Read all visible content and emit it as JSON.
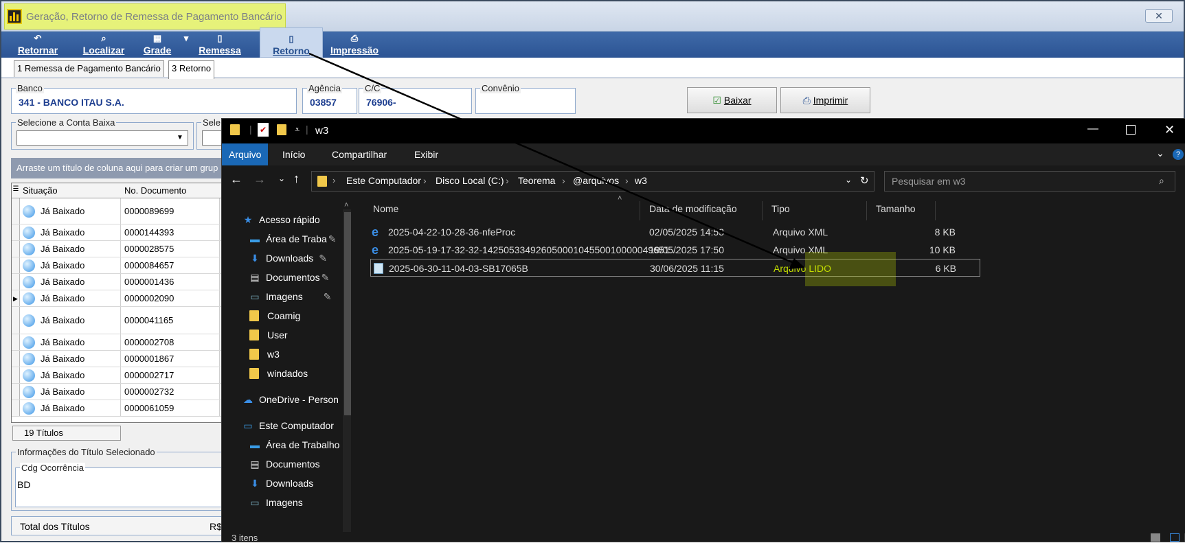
{
  "app": {
    "title": "Geração, Retorno de Remessa de Pagamento Bancário",
    "close": "✕"
  },
  "toolbar": {
    "retornar": "Retornar",
    "localizar": "Localizar",
    "grade": "Grade",
    "remessa": "Remessa",
    "retorno": "Retorno",
    "impressao": "Impressão"
  },
  "tabs": {
    "remessa": "1 Remessa de Pagamento Bancário",
    "retorno": "3 Retorno"
  },
  "form": {
    "banco_label": "Banco",
    "banco_value": "341 - BANCO ITAU S.A.",
    "agencia_label": "Agência",
    "agencia_value": "03857",
    "cc_label": "C/C",
    "cc_value": "76906-",
    "convenio_label": "Convênio",
    "baixar": "Baixar",
    "imprimir": "Imprimir",
    "conta_baixa_label": "Selecione a Conta Baixa",
    "sele_label": "Sele",
    "group_hint": "Arraste um título de coluna aqui para criar um grup"
  },
  "grid": {
    "col_situacao": "Situação",
    "col_documento": "No. Documento",
    "rows": [
      {
        "situacao": "Já Baixado",
        "documento": "0000089699"
      },
      {
        "situacao": "Já Baixado",
        "documento": "0000144393"
      },
      {
        "situacao": "Já Baixado",
        "documento": "0000028575"
      },
      {
        "situacao": "Já Baixado",
        "documento": "0000084657"
      },
      {
        "situacao": "Já Baixado",
        "documento": "0000001436"
      },
      {
        "situacao": "Já Baixado",
        "documento": "0000002090"
      },
      {
        "situacao": "Já Baixado",
        "documento": "0000041165"
      },
      {
        "situacao": "Já Baixado",
        "documento": "0000002708"
      },
      {
        "situacao": "Já Baixado",
        "documento": "0000001867"
      },
      {
        "situacao": "Já Baixado",
        "documento": "0000002717"
      },
      {
        "situacao": "Já Baixado",
        "documento": "0000002732"
      },
      {
        "situacao": "Já Baixado",
        "documento": "0000061059"
      }
    ],
    "count": "19 Títulos"
  },
  "info": {
    "title": "Informações do Título Selecionado",
    "cdg_label": "Cdg Ocorrência",
    "cdg_value": "BD",
    "total_label": "Total dos Títulos",
    "total_currency": "R$"
  },
  "explorer": {
    "title": "w3",
    "ribbon": [
      "Arquivo",
      "Início",
      "Compartilhar",
      "Exibir"
    ],
    "breadcrumb": [
      "Este Computador",
      "Disco Local (C:)",
      "Teorema",
      "@arquivos",
      "w3"
    ],
    "search_placeholder": "Pesquisar em w3",
    "nav": {
      "quick_access": "Acesso rápido",
      "area_trabalho": "Área de Traba",
      "downloads": "Downloads",
      "documentos": "Documentos",
      "imagens": "Imagens",
      "coamig": "Coamig",
      "user": "User",
      "w3": "w3",
      "windados": "windados",
      "onedrive": "OneDrive - Person",
      "este_computador": "Este Computador",
      "area_trabalho2": "Área de Trabalho",
      "documentos2": "Documentos",
      "downloads2": "Downloads",
      "imagens2": "Imagens"
    },
    "columns": {
      "nome": "Nome",
      "data": "Data de modificação",
      "tipo": "Tipo",
      "tamanho": "Tamanho"
    },
    "files": [
      {
        "nome": "2025-04-22-10-28-36-nfeProc",
        "data": "02/05/2025 14:53",
        "tipo": "Arquivo XML",
        "tamanho": "8 KB"
      },
      {
        "nome": "2025-05-19-17-32-32-1425053349260500010455001000004965​1...",
        "data": "19/05/2025 17:50",
        "tipo": "Arquivo XML",
        "tamanho": "10 KB"
      },
      {
        "nome": "2025-06-30-11-04-03-SB17065B",
        "data": "30/06/2025 11:15",
        "tipo": "Arquivo LIDO",
        "tamanho": "6 KB"
      }
    ],
    "status": "3 itens",
    "highlight_color": "#c4de00"
  }
}
